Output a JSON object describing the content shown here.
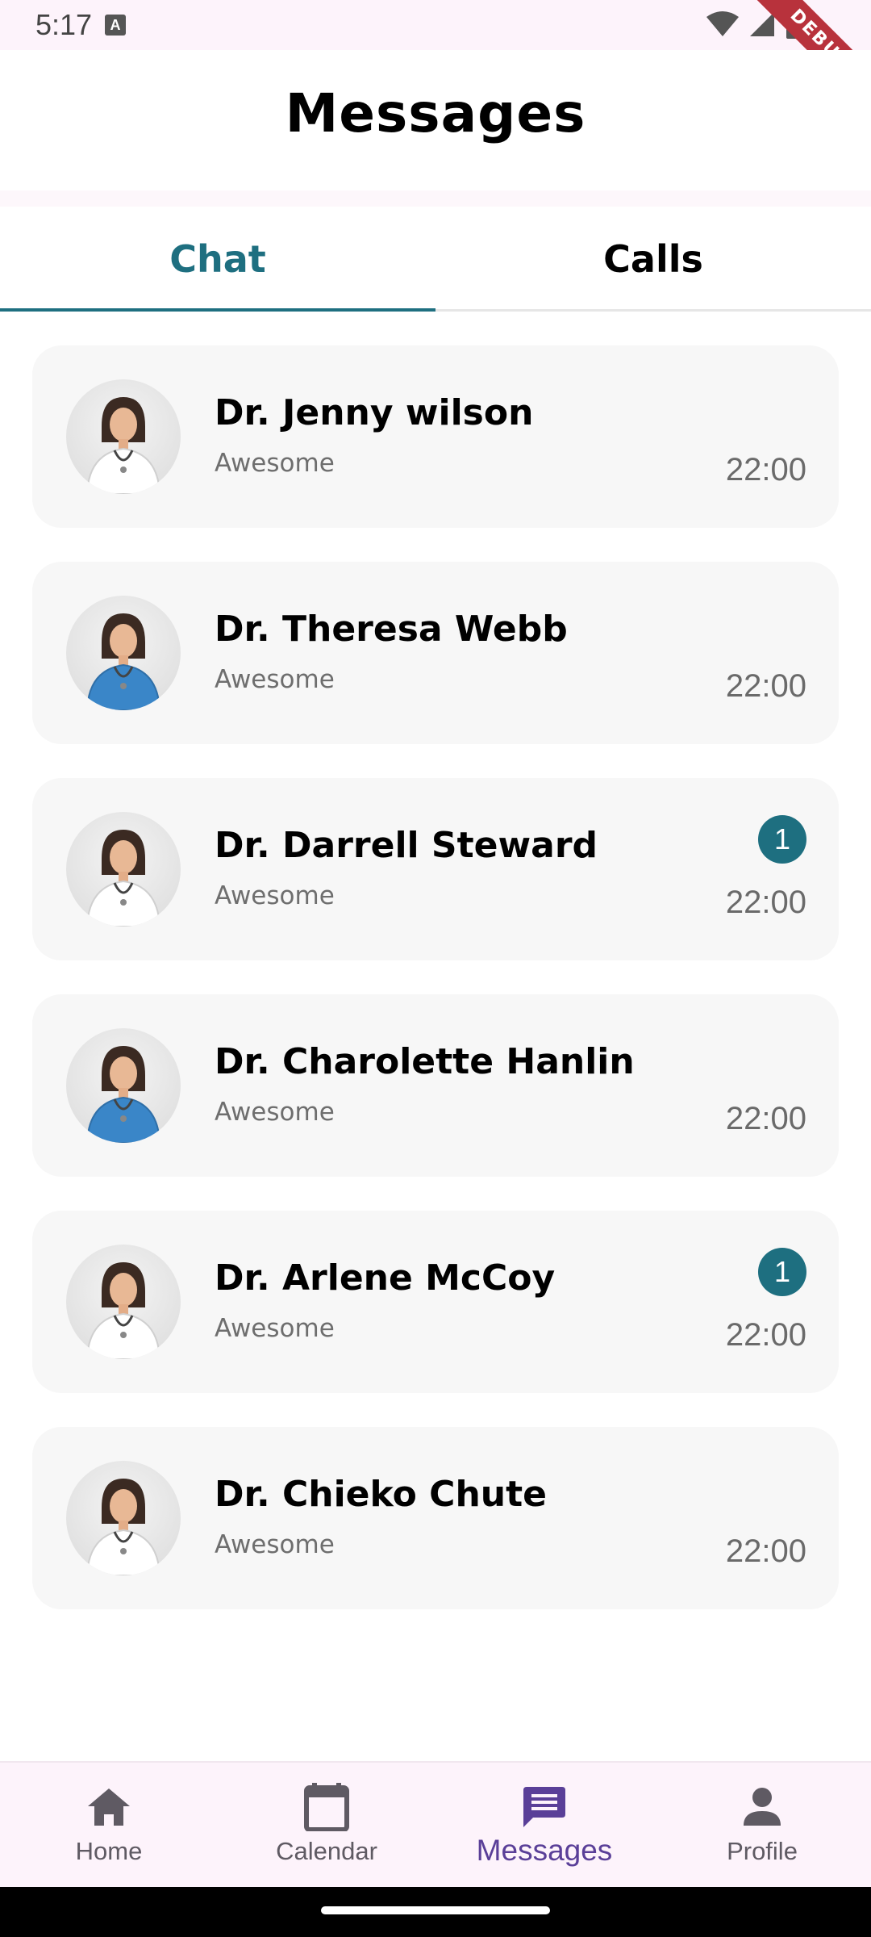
{
  "status_bar": {
    "time": "5:17",
    "keyboard_indicator": "A",
    "debug_label": "DEBUG",
    "icons": [
      "wifi-icon",
      "signal-icon",
      "battery-icon"
    ]
  },
  "header": {
    "title": "Messages"
  },
  "tabs": [
    {
      "label": "Chat",
      "active": true
    },
    {
      "label": "Calls",
      "active": false
    }
  ],
  "chats": [
    {
      "name": "Dr. Jenny wilson",
      "message": "Awesome",
      "time": "22:00",
      "unread": null,
      "scrub": "white-coat"
    },
    {
      "name": "Dr. Theresa Webb",
      "message": "Awesome",
      "time": "22:00",
      "unread": null,
      "scrub": "blue-scrubs"
    },
    {
      "name": "Dr. Darrell Steward",
      "message": "Awesome",
      "time": "22:00",
      "unread": "1",
      "scrub": "white-coat"
    },
    {
      "name": "Dr. Charolette Hanlin",
      "message": "Awesome",
      "time": "22:00",
      "unread": null,
      "scrub": "blue-scrubs"
    },
    {
      "name": "Dr. Arlene McCoy",
      "message": "Awesome",
      "time": "22:00",
      "unread": "1",
      "scrub": "white-coat"
    },
    {
      "name": "Dr. Chieko Chute",
      "message": "Awesome",
      "time": "22:00",
      "unread": null,
      "scrub": "white-coat"
    }
  ],
  "bottom_nav": [
    {
      "label": "Home",
      "icon": "home-icon",
      "active": false
    },
    {
      "label": "Calendar",
      "icon": "calendar-icon",
      "active": false
    },
    {
      "label": "Messages",
      "icon": "message-icon",
      "active": true
    },
    {
      "label": "Profile",
      "icon": "person-icon",
      "active": false
    }
  ],
  "colors": {
    "accent": "#1e6f80",
    "nav_active": "#5a3f98",
    "nav_inactive": "#5f5a63",
    "card_bg": "#f7f7f7"
  }
}
